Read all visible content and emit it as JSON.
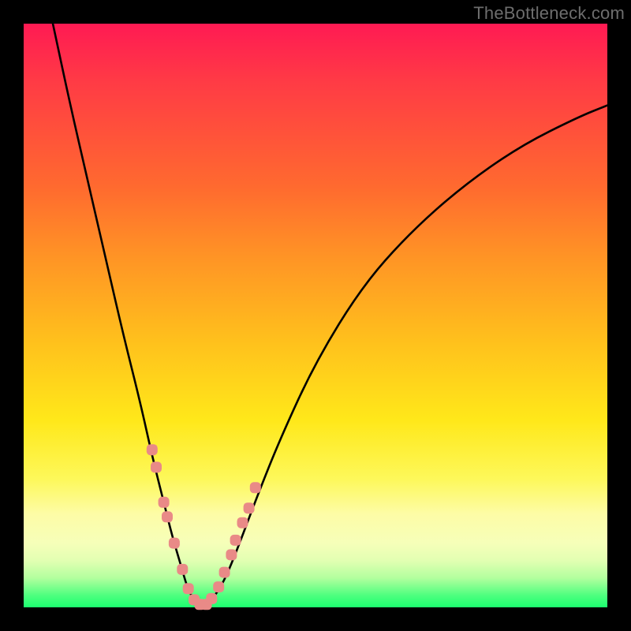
{
  "watermark": "TheBottleneck.com",
  "chart_data": {
    "type": "line",
    "title": "",
    "xlabel": "",
    "ylabel": "",
    "xlim": [
      0,
      100
    ],
    "ylim": [
      0,
      100
    ],
    "grid": false,
    "legend": false,
    "series": [
      {
        "name": "bottleneck-curve",
        "color": "#000000",
        "x": [
          5,
          8,
          11,
          14,
          17,
          20,
          22,
          24,
          25.5,
          27,
          28,
          29,
          30,
          31,
          32,
          33.5,
          35,
          37,
          40,
          44,
          50,
          58,
          66,
          75,
          85,
          95,
          100
        ],
        "y": [
          100,
          86,
          73,
          60,
          47,
          35,
          26,
          18,
          12,
          7,
          3.5,
          1.5,
          0.5,
          0.5,
          1.2,
          3,
          6,
          11,
          19,
          29,
          42,
          55,
          64,
          72,
          79,
          84,
          86
        ]
      }
    ],
    "markers": [
      {
        "name": "cluster-points",
        "color": "#e98a87",
        "shape": "rounded-square",
        "x": [
          22.0,
          22.7,
          24.0,
          24.6,
          25.8,
          27.2,
          28.2,
          29.2,
          30.2,
          31.3,
          32.2,
          33.4,
          34.4,
          35.6,
          36.3,
          37.5,
          38.6,
          39.7
        ],
        "y": [
          27.0,
          24.0,
          18.0,
          15.5,
          11.0,
          6.5,
          3.2,
          1.3,
          0.5,
          0.5,
          1.5,
          3.5,
          6.0,
          9.0,
          11.5,
          14.5,
          17.0,
          20.5
        ]
      }
    ],
    "background_gradient": {
      "direction": "top-to-bottom",
      "stops": [
        {
          "pos": 0.0,
          "color": "#ff1a53"
        },
        {
          "pos": 0.28,
          "color": "#ff6a2f"
        },
        {
          "pos": 0.55,
          "color": "#ffc21c"
        },
        {
          "pos": 0.78,
          "color": "#fdf85a"
        },
        {
          "pos": 0.92,
          "color": "#e2ffb2"
        },
        {
          "pos": 1.0,
          "color": "#1cff70"
        }
      ]
    }
  }
}
